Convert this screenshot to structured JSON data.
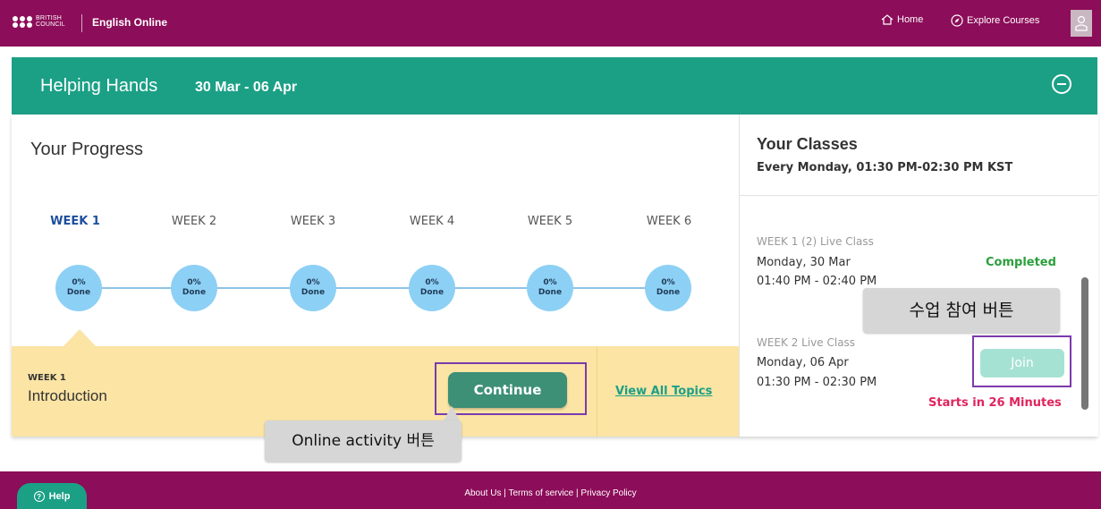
{
  "topbar": {
    "logo_line1": "BRITISH",
    "logo_line2": "COUNCIL",
    "app_name": "English Online",
    "home_label": "Home",
    "explore_label": "Explore Courses"
  },
  "course": {
    "title": "Helping Hands",
    "dates": "30 Mar - 06 Apr"
  },
  "progress": {
    "title": "Your Progress",
    "weeks": [
      {
        "label": "WEEK 1",
        "percent": "0%",
        "done": "Done"
      },
      {
        "label": "WEEK 2",
        "percent": "0%",
        "done": "Done"
      },
      {
        "label": "WEEK 3",
        "percent": "0%",
        "done": "Done"
      },
      {
        "label": "WEEK 4",
        "percent": "0%",
        "done": "Done"
      },
      {
        "label": "WEEK 5",
        "percent": "0%",
        "done": "Done"
      },
      {
        "label": "WEEK 6",
        "percent": "0%",
        "done": "Done"
      }
    ],
    "active_week": 1,
    "topic_week": "WEEK 1",
    "topic_name": "Introduction",
    "continue_label": "Continue",
    "view_all_label": "View All Topics"
  },
  "classes": {
    "title": "Your Classes",
    "schedule": "Every Monday, 01:30 PM-02:30 PM KST",
    "items": [
      {
        "label": "WEEK 1 (2) Live Class",
        "date": "Monday, 30 Mar",
        "time": "01:40 PM - 02:40 PM",
        "status": "Completed"
      },
      {
        "label": "WEEK 2 Live Class",
        "date": "Monday, 06 Apr",
        "time": "01:30 PM - 02:30 PM",
        "status": "Starts in 26 Minutes",
        "join_label": "Join"
      }
    ]
  },
  "callouts": {
    "join": "수업 참여 버튼",
    "continue": "Online activity 버튼"
  },
  "footer": {
    "help_label": "Help",
    "about": "About Us",
    "terms": "Terms of service",
    "privacy": "Privacy Policy",
    "separator": " | "
  },
  "colors": {
    "brand": "#8c0d59",
    "accent": "#1ba086",
    "completed": "#2b9f3c",
    "alert": "#e0245e"
  }
}
